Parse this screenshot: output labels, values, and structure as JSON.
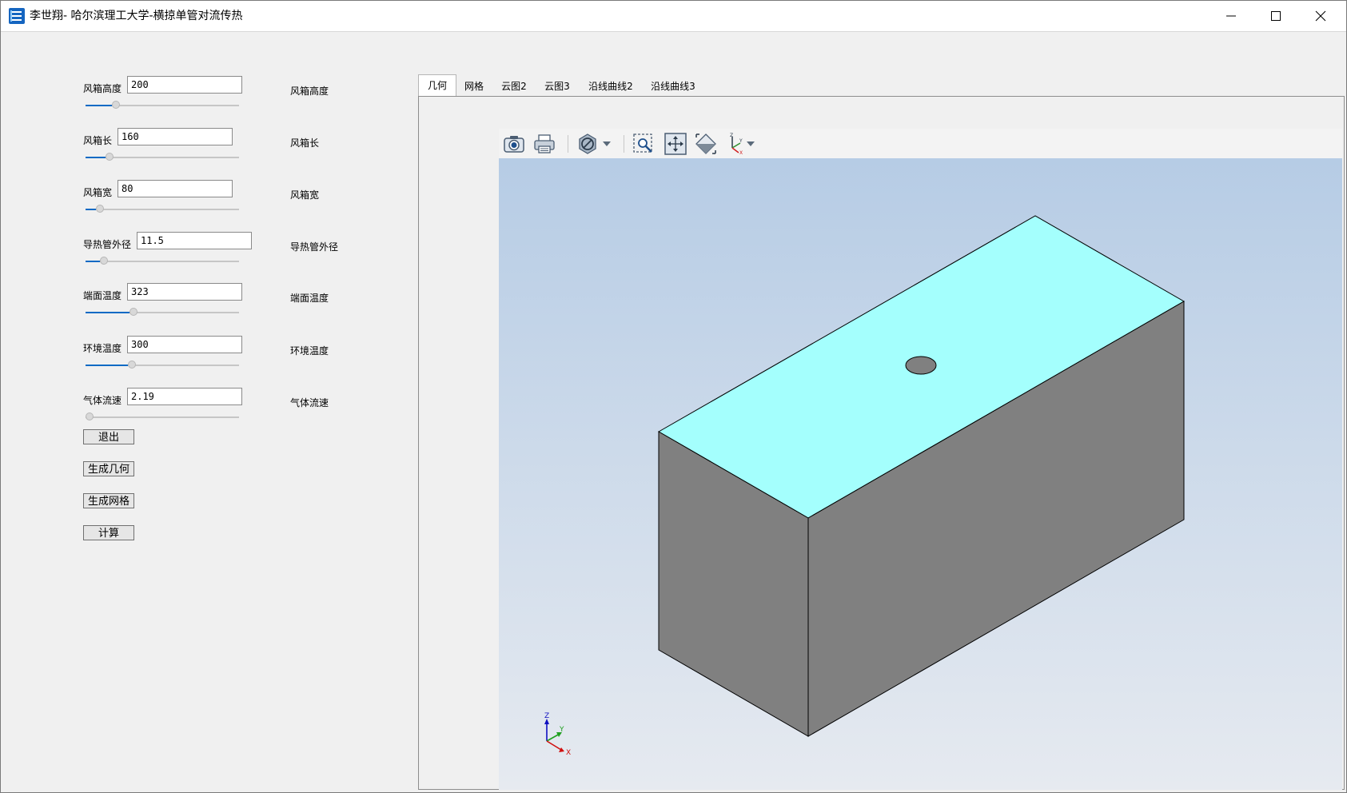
{
  "window": {
    "title": "李世翔- 哈尔滨理工大学-横掠单管对流传热"
  },
  "params": [
    {
      "label": "风箱高度",
      "value": "200",
      "right_label": "风箱高度",
      "slider": 0.18
    },
    {
      "label": "风箱长",
      "value": "160",
      "right_label": "风箱长",
      "slider": 0.14
    },
    {
      "label": "风箱宽",
      "value": "80",
      "right_label": "风箱宽",
      "slider": 0.07
    },
    {
      "label": "导热管外径",
      "value": "11.5",
      "right_label": "导热管外径",
      "slider": 0.1
    },
    {
      "label": "端面温度",
      "value": "323",
      "right_label": "端面温度",
      "slider": 0.3
    },
    {
      "label": "环境温度",
      "value": "300",
      "right_label": "环境温度",
      "slider": 0.29
    },
    {
      "label": "气体流速",
      "value": "2.19",
      "right_label": "气体流速",
      "slider": 0.0
    }
  ],
  "buttons": {
    "exit": "退出",
    "gen_geometry": "生成几何",
    "gen_mesh": "生成网格",
    "compute": "计算"
  },
  "tabs": [
    "几何",
    "网格",
    "云图2",
    "云图3",
    "沿线曲线2",
    "沿线曲线3"
  ],
  "active_tab": 0,
  "triad": {
    "x": "X",
    "y": "Y",
    "z": "Z"
  },
  "toolbar_icons": [
    "camera-icon",
    "print-icon",
    "hide-icon",
    "zoom-box-icon",
    "zoom-extents-icon",
    "scene-light-icon",
    "axis-view-icon"
  ],
  "colors": {
    "box_top": "#a4fffd",
    "box_sides": "#808080",
    "hole": "#808080",
    "slider_fill": "#0b6ac4"
  }
}
